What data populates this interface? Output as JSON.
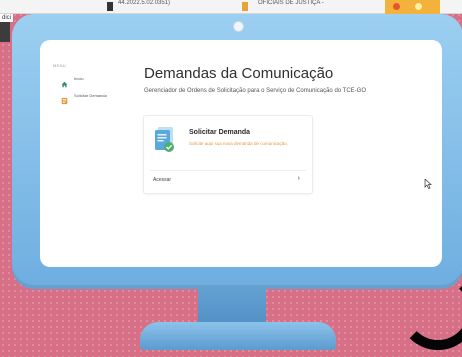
{
  "browser_strip": {
    "frag_left": "dici",
    "frag_tab1": "44.2022.5.02.0351)",
    "frag_tab2": "OFICIAIS DE JUSTIÇA -"
  },
  "sidebar": {
    "menu_label": "MENU",
    "items": [
      {
        "label": "Início",
        "icon": "home-icon"
      },
      {
        "label": "Solicitar Demanda",
        "icon": "document-icon"
      }
    ]
  },
  "main": {
    "title": "Demandas da Comunicação",
    "subtitle": "Gerenciador de Ordens de Solicitação para o Serviço de Comunicação do TCE-GO"
  },
  "card": {
    "title": "Solicitar Demanda",
    "description": "Solicite aqui sua nova demanda de comunicação.",
    "link_label": "Acessar",
    "chevron": "›",
    "icon": "document-check-icon"
  },
  "colors": {
    "accent": "#e39a3e",
    "monitor": "#8cc3ea",
    "background": "#d76f86",
    "nav_icon": "#2f8f6b"
  }
}
